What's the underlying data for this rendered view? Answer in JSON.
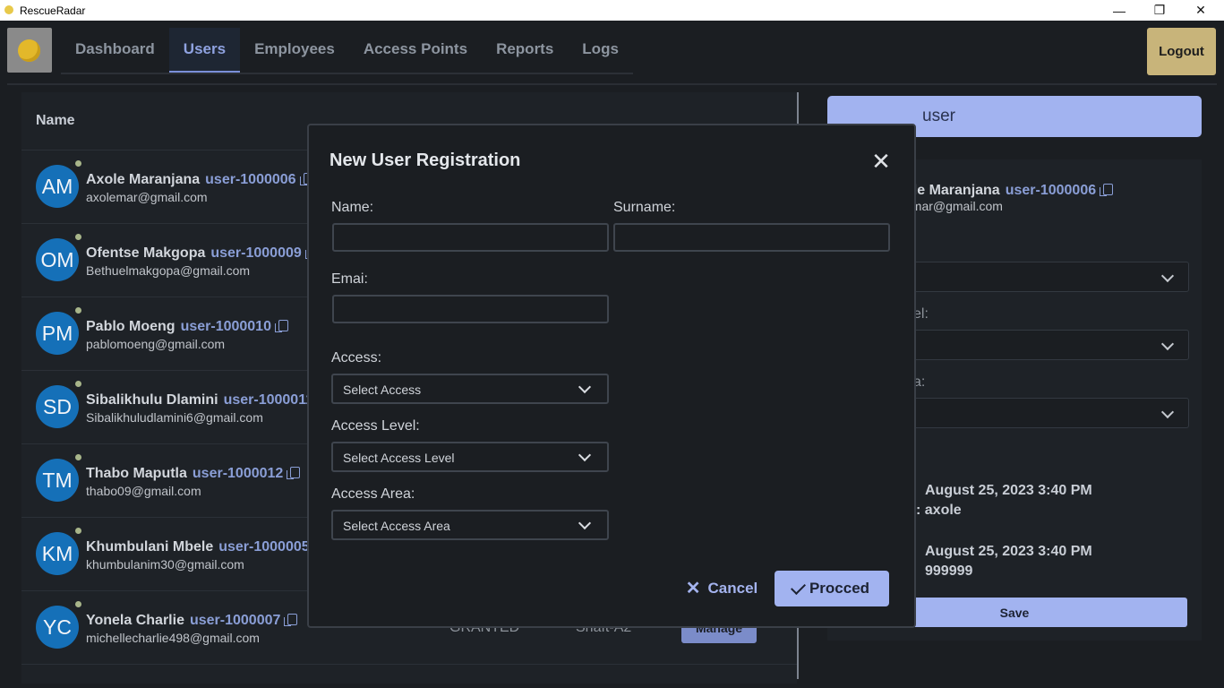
{
  "window": {
    "title": "RescueRadar",
    "minimize": "—",
    "maximize": "❐",
    "close": "✕"
  },
  "nav": {
    "tabs": [
      {
        "label": "Dashboard"
      },
      {
        "label": "Users",
        "active": true
      },
      {
        "label": "Employees"
      },
      {
        "label": "Access Points"
      },
      {
        "label": "Reports"
      },
      {
        "label": "Logs"
      }
    ],
    "logout": "Logout"
  },
  "users": {
    "column_name": "Name",
    "rows": [
      {
        "initials": "AM",
        "name": "Axole Maranjana",
        "id": "user-1000006",
        "email": "axolemar@gmail.com"
      },
      {
        "initials": "OM",
        "name": "Ofentse Makgopa",
        "id": "user-1000009",
        "email": "Bethuelmakgopa@gmail.com"
      },
      {
        "initials": "PM",
        "name": "Pablo Moeng",
        "id": "user-1000010",
        "email": "pablomoeng@gmail.com"
      },
      {
        "initials": "SD",
        "name": "Sibalikhulu Dlamini",
        "id": "user-1000011",
        "email": "Sibalikhuludlamini6@gmail.com"
      },
      {
        "initials": "TM",
        "name": "Thabo Maputla",
        "id": "user-1000012",
        "email": "thabo09@gmail.com"
      },
      {
        "initials": "KM",
        "name": "Khumbulani Mbele",
        "id": "user-1000005",
        "email": "khumbulanim30@gmail.com"
      },
      {
        "initials": "YC",
        "name": "Yonela Charlie",
        "id": "user-1000007",
        "email": "michellecharlie498@gmail.com",
        "access": "GRANTED",
        "area": "Shaft-A2",
        "action": "Manage"
      }
    ]
  },
  "search": {
    "text": "user"
  },
  "detail": {
    "name": "ole Maranjana",
    "id": "user-1000006",
    "email": "emar@gmail.com",
    "label_level": "el:",
    "label_area": "a:",
    "created": "August 25, 2023 3:40 PM",
    "created_by": ": axole",
    "updated": "August 25, 2023 3:40 PM",
    "updated_by": "999999",
    "save": "Save"
  },
  "modal": {
    "title": "New User Registration",
    "close": "✕",
    "name_label": "Name:",
    "surname_label": "Surname:",
    "email_label": "Emai:",
    "access_label": "Access:",
    "access_placeholder": "Select Access",
    "level_label": "Access Level:",
    "level_placeholder": "Select Access Level",
    "area_label": "Access Area:",
    "area_placeholder": "Select Access Area",
    "cancel": "Cancel",
    "proceed": "Procced",
    "name_value": "",
    "surname_value": "",
    "email_value": ""
  }
}
